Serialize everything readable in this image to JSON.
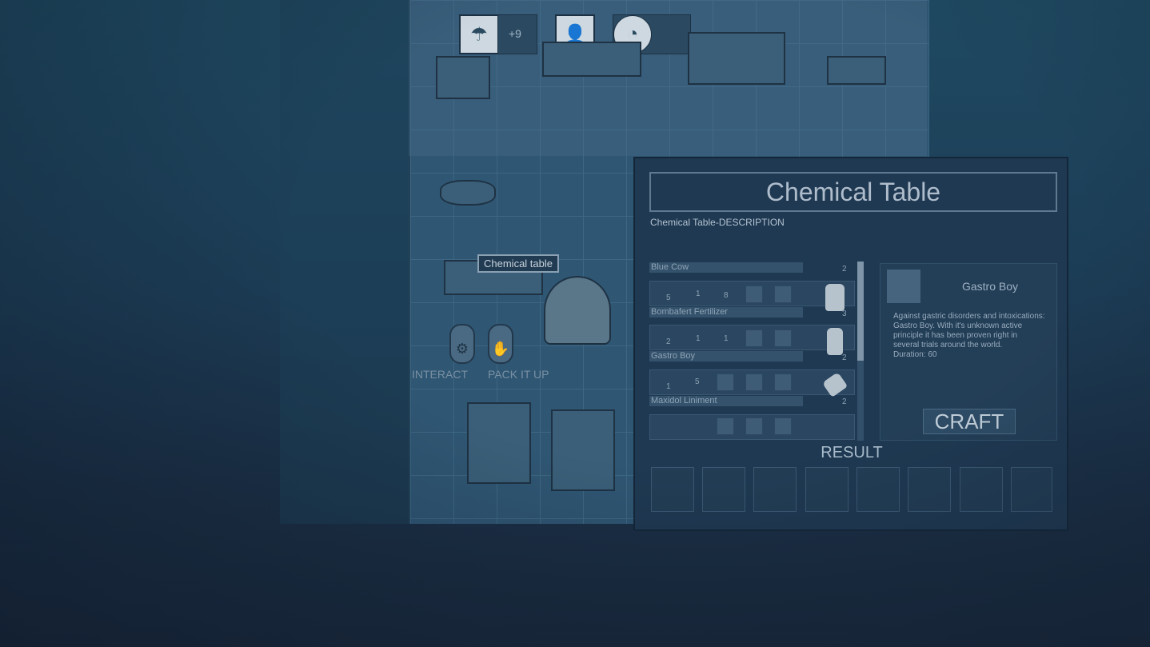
{
  "hud": {
    "room_label": "",
    "weather_value": "+9",
    "time_lines": [
      "",
      ""
    ],
    "weather_icon": "rain-cloud-icon",
    "person_icon": "person-icon",
    "clock_icon": "clock-icon"
  },
  "world": {
    "tooltip": "Chemical table",
    "controls": {
      "interact_label": "INTERACT",
      "pack_label": "PACK IT UP"
    }
  },
  "panel": {
    "title": "Chemical Table",
    "description": "Chemical Table-DESCRIPTION",
    "recipes": [
      {
        "name": "Blue Cow",
        "result_qty": "2",
        "ingredients": []
      },
      {
        "name": "Bombafert Fertilizer",
        "result_qty": "3",
        "ingredients": [
          {
            "qty": "5"
          },
          {
            "qty": "1"
          },
          {
            "qty": "8"
          }
        ]
      },
      {
        "name": "Gastro Boy",
        "result_qty": "2",
        "ingredients": [
          {
            "qty": "2"
          },
          {
            "qty": "1"
          },
          {
            "qty": "1"
          }
        ]
      },
      {
        "name": "Maxidol Liniment",
        "result_qty": "2",
        "ingredients": [
          {
            "qty": "1"
          },
          {
            "qty": "5"
          }
        ]
      },
      {
        "name": "",
        "result_qty": "",
        "ingredients": [
          {
            "qty": ""
          },
          {
            "qty": ""
          }
        ]
      }
    ],
    "selected": {
      "name": "Gastro Boy",
      "description": "Against gastric disorders and intoxications: Gastro Boy. With it's unknown active principle it has been proven right in several trials around the world.",
      "duration": "Duration: 60"
    },
    "craft_label": "CRAFT",
    "result_label": "RESULT",
    "result_slot_count": 8
  },
  "colors": {
    "panel_bg": "#1f3952",
    "accent_text": "#aebccb",
    "room_floor": "#2f5673"
  }
}
